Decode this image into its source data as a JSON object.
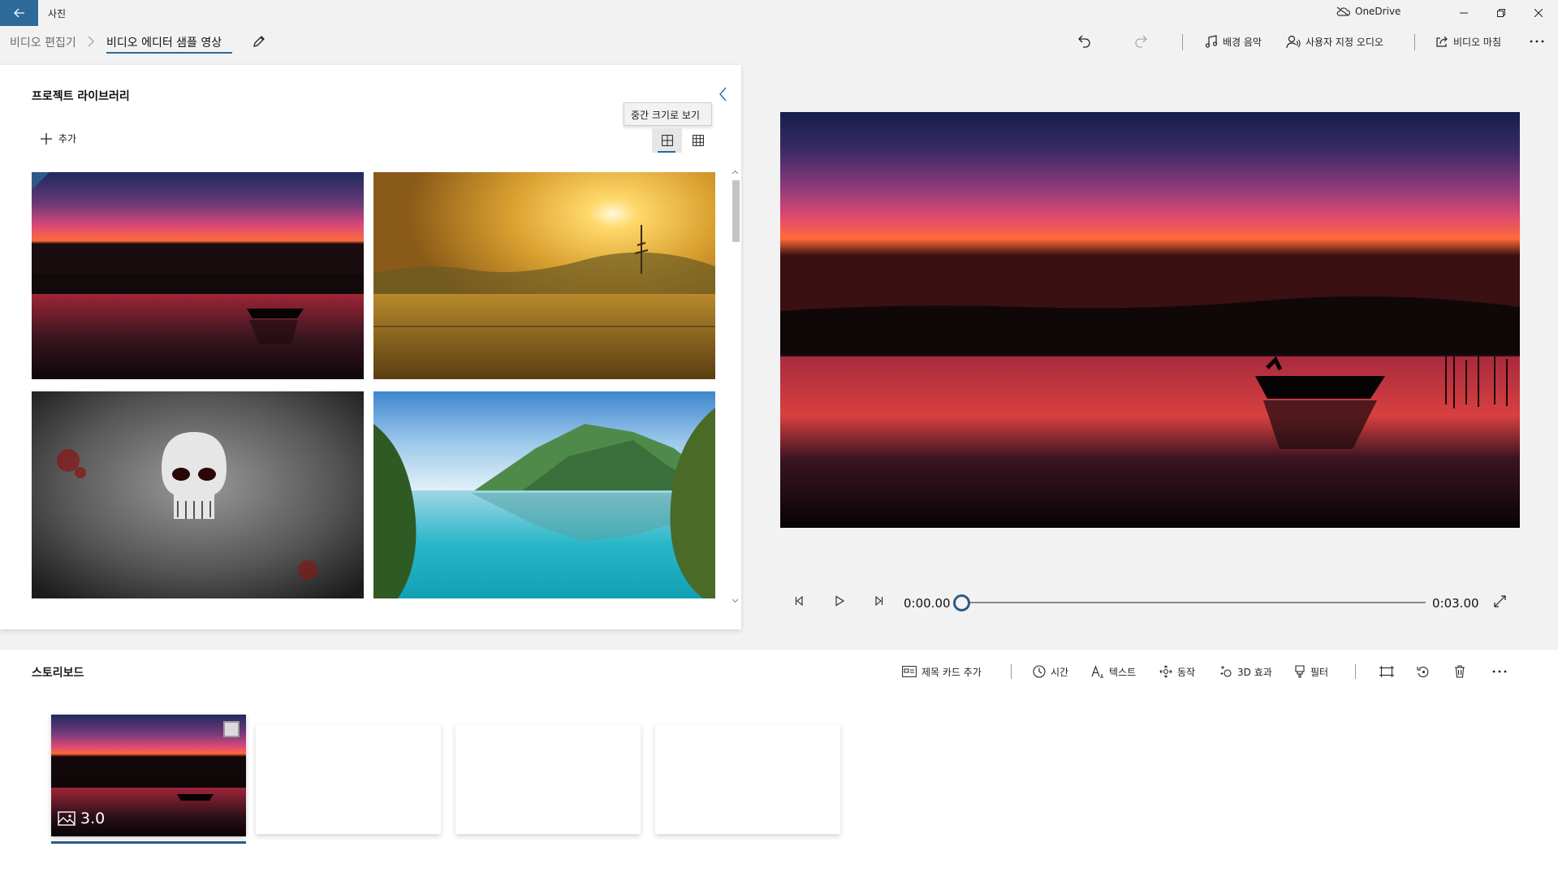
{
  "window": {
    "app_title": "사진",
    "onedrive_label": "OneDrive"
  },
  "toolbar": {
    "breadcrumb_root": "비디오 편집기",
    "project_name": "비디오 에디터 샘플 영상",
    "background_music": "배경 음악",
    "custom_audio": "사용자 지정 오디오",
    "finish_video": "비디오 마침"
  },
  "library": {
    "title": "프로젝트 라이브러리",
    "add_label": "추가",
    "tooltip": "중간 크기로 보기"
  },
  "player": {
    "current_time": "0:00.00",
    "total_time": "0:03.00",
    "progress": 0
  },
  "storyboard": {
    "title": "스토리보드",
    "add_title_card": "제목 카드 추가",
    "duration_btn": "시간",
    "text_btn": "텍스트",
    "motion_btn": "동작",
    "effects_3d_btn": "3D 효과",
    "filters_btn": "필터",
    "clip_duration": "3.0"
  },
  "colors": {
    "accent": "#2d6a9a",
    "titlebar_bg": "#f2f2f2"
  }
}
